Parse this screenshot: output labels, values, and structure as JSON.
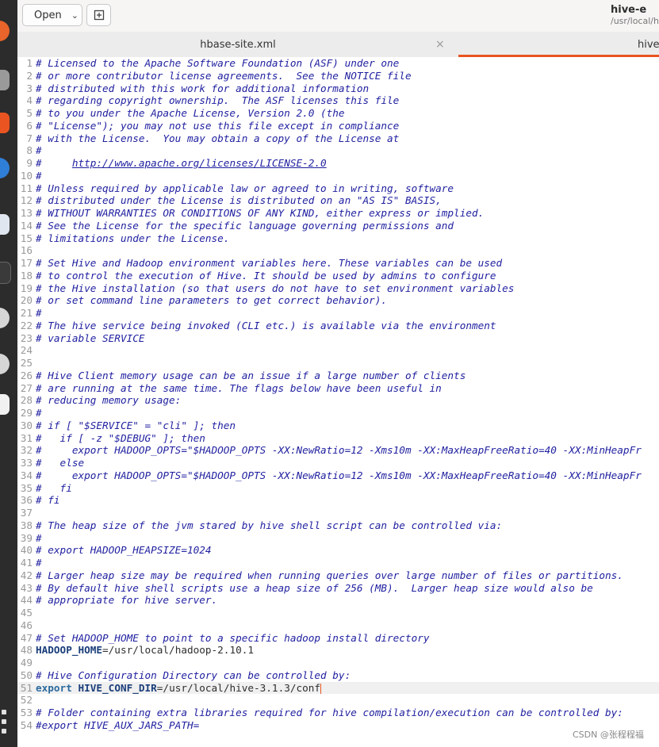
{
  "header": {
    "open_label": "Open",
    "title": "hive-e",
    "subtitle": "/usr/local/hiv"
  },
  "tabs": [
    {
      "label": "hbase-site.xml",
      "close": "×"
    },
    {
      "label": "hive-"
    }
  ],
  "editor": {
    "current_line": 51,
    "lines": [
      {
        "n": 1,
        "text": "# Licensed to the Apache Software Foundation (ASF) under one"
      },
      {
        "n": 2,
        "text": "# or more contributor license agreements.  See the NOTICE file"
      },
      {
        "n": 3,
        "text": "# distributed with this work for additional information"
      },
      {
        "n": 4,
        "text": "# regarding copyright ownership.  The ASF licenses this file"
      },
      {
        "n": 5,
        "text": "# to you under the Apache License, Version 2.0 (the"
      },
      {
        "n": 6,
        "text": "# \"License\"); you may not use this file except in compliance"
      },
      {
        "n": 7,
        "text": "# with the License.  You may obtain a copy of the License at"
      },
      {
        "n": 8,
        "text": "#"
      },
      {
        "n": 9,
        "text": "#     ",
        "link": "http://www.apache.org/licenses/LICENSE-2.0"
      },
      {
        "n": 10,
        "text": "#"
      },
      {
        "n": 11,
        "text": "# Unless required by applicable law or agreed to in writing, software"
      },
      {
        "n": 12,
        "text": "# distributed under the License is distributed on an \"AS IS\" BASIS,"
      },
      {
        "n": 13,
        "text": "# WITHOUT WARRANTIES OR CONDITIONS OF ANY KIND, either express or implied."
      },
      {
        "n": 14,
        "text": "# See the License for the specific language governing permissions and"
      },
      {
        "n": 15,
        "text": "# limitations under the License."
      },
      {
        "n": 16,
        "text": ""
      },
      {
        "n": 17,
        "text": "# Set Hive and Hadoop environment variables here. These variables can be used"
      },
      {
        "n": 18,
        "text": "# to control the execution of Hive. It should be used by admins to configure"
      },
      {
        "n": 19,
        "text": "# the Hive installation (so that users do not have to set environment variables"
      },
      {
        "n": 20,
        "text": "# or set command line parameters to get correct behavior)."
      },
      {
        "n": 21,
        "text": "#"
      },
      {
        "n": 22,
        "text": "# The hive service being invoked (CLI etc.) is available via the environment"
      },
      {
        "n": 23,
        "text": "# variable SERVICE"
      },
      {
        "n": 24,
        "text": ""
      },
      {
        "n": 25,
        "text": ""
      },
      {
        "n": 26,
        "text": "# Hive Client memory usage can be an issue if a large number of clients"
      },
      {
        "n": 27,
        "text": "# are running at the same time. The flags below have been useful in"
      },
      {
        "n": 28,
        "text": "# reducing memory usage:"
      },
      {
        "n": 29,
        "text": "#"
      },
      {
        "n": 30,
        "text": "# if [ \"$SERVICE\" = \"cli\" ]; then"
      },
      {
        "n": 31,
        "text": "#   if [ -z \"$DEBUG\" ]; then"
      },
      {
        "n": 32,
        "text": "#     export HADOOP_OPTS=\"$HADOOP_OPTS -XX:NewRatio=12 -Xms10m -XX:MaxHeapFreeRatio=40 -XX:MinHeapFr"
      },
      {
        "n": 33,
        "text": "#   else"
      },
      {
        "n": 34,
        "text": "#     export HADOOP_OPTS=\"$HADOOP_OPTS -XX:NewRatio=12 -Xms10m -XX:MaxHeapFreeRatio=40 -XX:MinHeapFr"
      },
      {
        "n": 35,
        "text": "#   fi"
      },
      {
        "n": 36,
        "text": "# fi"
      },
      {
        "n": 37,
        "text": ""
      },
      {
        "n": 38,
        "text": "# The heap size of the jvm stared by hive shell script can be controlled via:"
      },
      {
        "n": 39,
        "text": "#"
      },
      {
        "n": 40,
        "text": "# export HADOOP_HEAPSIZE=1024"
      },
      {
        "n": 41,
        "text": "#"
      },
      {
        "n": 42,
        "text": "# Larger heap size may be required when running queries over large number of files or partitions."
      },
      {
        "n": 43,
        "text": "# By default hive shell scripts use a heap size of 256 (MB).  Larger heap size would also be"
      },
      {
        "n": 44,
        "text": "# appropriate for hive server."
      },
      {
        "n": 45,
        "text": ""
      },
      {
        "n": 46,
        "text": ""
      },
      {
        "n": 47,
        "text": "# Set HADOOP_HOME to point to a specific hadoop install directory"
      },
      {
        "n": 48,
        "var": "HADOOP_HOME",
        "rest": "=/usr/local/hadoop-2.10.1"
      },
      {
        "n": 49,
        "text": ""
      },
      {
        "n": 50,
        "text": "# Hive Configuration Directory can be controlled by:"
      },
      {
        "n": 51,
        "kw": "export ",
        "var": "HIVE_CONF_DIR",
        "rest": "=/usr/local/hive-3.1.3/conf"
      },
      {
        "n": 52,
        "text": ""
      },
      {
        "n": 53,
        "text": "# Folder containing extra libraries required for hive compilation/execution can be controlled by:"
      },
      {
        "n": 54,
        "text": "#export HIVE_AUX_JARS_PATH="
      }
    ]
  },
  "watermark": "CSDN @张程程福"
}
